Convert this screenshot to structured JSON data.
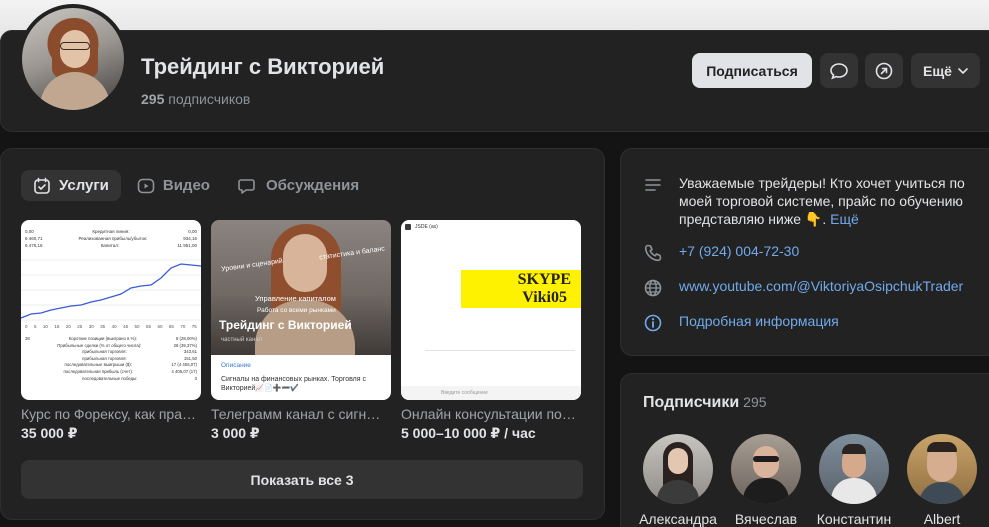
{
  "group": {
    "title": "Трейдинг с Викторией",
    "subscribers_count": "295",
    "subscribers_label": "подписчиков"
  },
  "actions": {
    "subscribe_label": "Подписаться",
    "more_label": "Ещё"
  },
  "tabs": [
    {
      "label": "Услуги",
      "active": true,
      "icon": "services-icon"
    },
    {
      "label": "Видео",
      "active": false,
      "icon": "video-icon"
    },
    {
      "label": "Обсуждения",
      "active": false,
      "icon": "discussions-icon"
    }
  ],
  "services": [
    {
      "name": "Курс по Форексу, как пра…",
      "price": "35 000 ₽",
      "thumb": {
        "rows": [
          [
            "0,00",
            "Кредитная линия:",
            "0,00"
          ],
          [
            "6 460,71",
            "Реализованная прибыль/убыток:",
            "934,16"
          ],
          [
            "6 476,16",
            "Капитал:",
            "11 951,00"
          ]
        ],
        "axis": [
          "0",
          "5",
          "10",
          "15",
          "20",
          "25",
          "30",
          "35",
          "40",
          "45",
          "50",
          "55",
          "60",
          "65",
          "70",
          "75"
        ],
        "footer_rows": [
          [
            "38",
            "Короткие позиции (выиграно в %):",
            "8 (28,00%)"
          ],
          [
            "",
            "Прибыльные сделки (% от общего числа):",
            "28 (39,37%)"
          ],
          [
            "",
            "прибыльная торговля:",
            "343,61"
          ],
          [
            "",
            "прибыльная торговля:",
            "151,50"
          ],
          [
            "",
            "последовательные выигрыши ($):",
            "17 (4 406,07)"
          ],
          [
            "",
            "последовательная прибыль (счет):",
            "4 406,07 (17)"
          ],
          [
            "",
            "последовательные победы:",
            "3"
          ]
        ]
      }
    },
    {
      "name": "Телеграмм канал с сигн…",
      "price": "3 000 ₽",
      "thumb": {
        "overlay_lines": [
          "статистика и баланс",
          "Уровни и сценарий",
          "Управление капиталом",
          "Работа со всеми рынками"
        ],
        "overlay_title": "Трейдинг с Викторией",
        "overlay_sub": "частный канал",
        "desc_label": "Описание",
        "desc_text": "Сигналы на финансовых рынках. Торговля с Викторией📈📄➕➖✔️"
      }
    },
    {
      "name": "Онлайн консультации по…",
      "price": "5 000–10 000 ₽ / час",
      "thumb": {
        "banner_line1": "SKYPE",
        "banner_line2": "Viki05",
        "top_label": "JSDE (as)",
        "bottom_label": "Введите сообщение"
      }
    }
  ],
  "show_all_label": "Показать все 3",
  "about": {
    "description": "Уважаемые трейдеры! Кто хочет учиться по моей торговой системе, прайс по обучению представляю ниже 👇.",
    "more_link": "Ещё",
    "phone": "+7 (924) 004-72-30",
    "website": "www.youtube.com/@ViktoriyaOsipchukTrader",
    "details_link": "Подробная информация"
  },
  "subscribers_block": {
    "title": "Подписчики",
    "count": "295",
    "members": [
      {
        "name": "Александра"
      },
      {
        "name": "Вячеслав"
      },
      {
        "name": "Константин"
      },
      {
        "name": "Albert"
      }
    ]
  },
  "colors": {
    "background": "#141414",
    "card": "#222222",
    "accent_link": "#71aaeb",
    "button": "#333333",
    "primary_button": "#e1e3e6",
    "skype_banner": "#fff200"
  }
}
